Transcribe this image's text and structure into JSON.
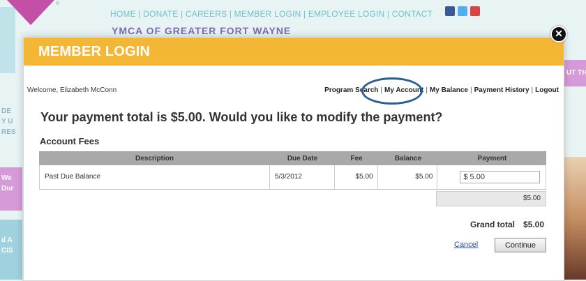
{
  "background": {
    "nav_text": "HOME | DONATE | CAREERS | MEMBER LOGIN | EMPLOYEE LOGIN | CONTACT",
    "org_name": "YMCA OF GREATER FORT WAYNE",
    "left_fragments": [
      "DE",
      "Y U",
      "RES",
      "We",
      "Dur",
      "d A",
      "CIS"
    ],
    "right_fragment": "UT TH",
    "social_icons": [
      "facebook-icon",
      "twitter-icon",
      "youtube-icon"
    ],
    "colors": {
      "site_bg": "#e8f3f4",
      "nav": "#6fc2cf",
      "logo": "#c34fa6"
    }
  },
  "modal": {
    "title": "MEMBER LOGIN",
    "close_icon": "close-icon",
    "header_color": "#f4b635"
  },
  "account": {
    "welcome": "Welcome, Elizabeth McConn",
    "nav": [
      "Program Search",
      "My Account",
      "My Balance",
      "Payment History",
      "Logout"
    ],
    "separator": "|"
  },
  "payment": {
    "question": "Your payment total is $5.00. Would you like to modify the payment?",
    "section_title": "Account Fees",
    "columns": [
      "Description",
      "Due Date",
      "Fee",
      "Balance",
      "Payment"
    ],
    "rows": [
      {
        "description": "Past Due Balance",
        "due_date": "5/3/2012",
        "fee": "$5.00",
        "balance": "$5.00",
        "payment": "$ 5.00"
      }
    ],
    "subtotal": "$5.00",
    "grand_total_label": "Grand total",
    "grand_total_value": "$5.00",
    "cancel_label": "Cancel",
    "continue_label": "Continue"
  }
}
